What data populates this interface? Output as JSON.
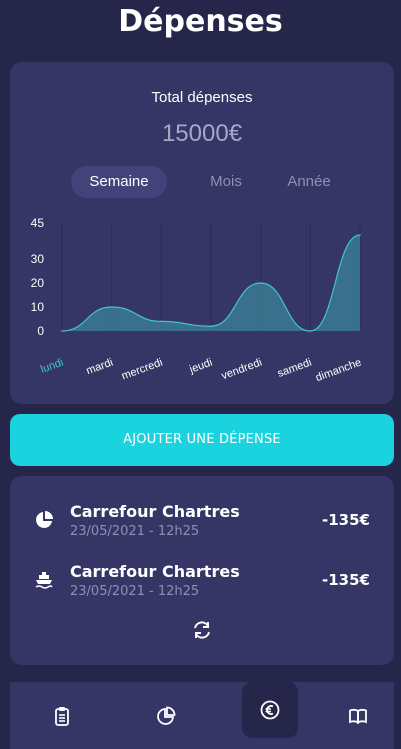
{
  "header": {
    "title": "Dépenses"
  },
  "summary": {
    "label": "Total dépenses",
    "amount": "15000€",
    "tabs": [
      {
        "label": "Semaine",
        "active": true
      },
      {
        "label": "Mois",
        "active": false
      },
      {
        "label": "Année",
        "active": false
      }
    ]
  },
  "chart_data": {
    "type": "area",
    "categories": [
      "lundi",
      "mardi",
      "mercredi",
      "jeudi",
      "vendredi",
      "samedi",
      "dimanche"
    ],
    "values": [
      0,
      10,
      4,
      2,
      20,
      0,
      40
    ],
    "yticks": [
      0,
      10,
      20,
      30,
      45
    ],
    "ylim": [
      0,
      45
    ],
    "highlight_category": "lundi",
    "grid": "vertical",
    "colors": {
      "line": "#3fc6cf",
      "fill": "#3a7a92",
      "highlight": "#3fc6cf",
      "label": "#ffffff"
    }
  },
  "cta": {
    "label": "AJOUTER UNE DÉPENSE"
  },
  "transactions": [
    {
      "icon": "pie-chart-icon",
      "title": "Carrefour Chartres",
      "date": "23/05/2021 - 12h25",
      "amount": "-135€"
    },
    {
      "icon": "ship-icon",
      "title": "Carrefour Chartres",
      "date": "23/05/2021 - 12h25",
      "amount": "-135€"
    }
  ],
  "refresh": {
    "icon": "refresh-icon"
  },
  "navbar": {
    "items": [
      {
        "icon": "clipboard-icon",
        "active": false
      },
      {
        "icon": "pie-chart-icon",
        "active": false
      },
      {
        "icon": "euro-icon",
        "active": true
      },
      {
        "icon": "book-icon",
        "active": false
      }
    ]
  },
  "colors": {
    "background": "#26264a",
    "card": "#363666",
    "accent": "#1ad3df",
    "muted": "#8f90b3"
  }
}
